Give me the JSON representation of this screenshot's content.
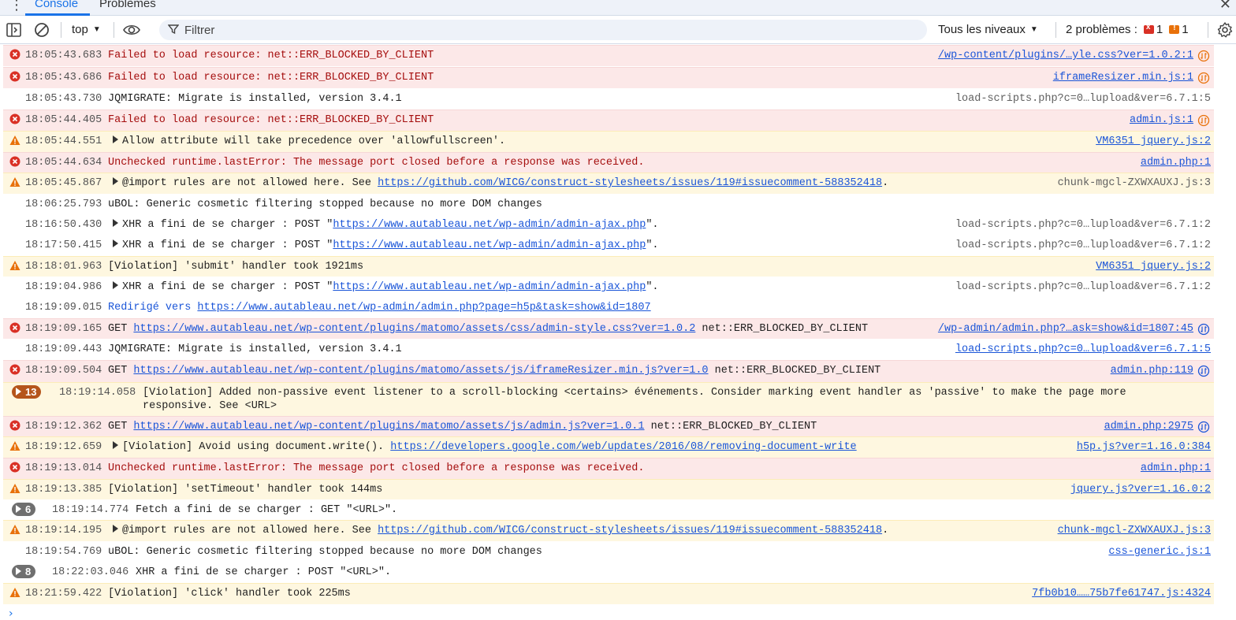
{
  "tabs": [
    {
      "label": "Console",
      "active": true
    },
    {
      "label": "Problèmes",
      "active": false
    }
  ],
  "toolbar": {
    "context": "top",
    "filter_placeholder": "Filtrer",
    "levels": "Tous les niveaux",
    "issues_label": "2 problèmes :",
    "issues_errors": "1",
    "issues_warnings": "1"
  },
  "colors": {
    "accent": "#1a73e8",
    "error_bg": "#fce8e8",
    "warning_bg": "#fef7e0",
    "error_icon": "#d93025",
    "warning_icon": "#e8710a"
  },
  "rows": [
    {
      "level": "error",
      "ts": "18:05:43.683",
      "msg": "Failed to load resource: net::ERR_BLOCKED_BY_CLIENT",
      "src": "/wp-content/plugins/…yle.css?ver=1.0.2:1",
      "src_icon": "blocked-request-icon"
    },
    {
      "level": "error",
      "ts": "18:05:43.686",
      "msg": "Failed to load resource: net::ERR_BLOCKED_BY_CLIENT",
      "src": "iframeResizer.min.js:1",
      "src_icon": "blocked-request-icon"
    },
    {
      "level": "info",
      "ts": "18:05:43.730",
      "msg": "JQMIGRATE: Migrate is installed, version 3.4.1",
      "src": "load-scripts.php?c=0…lupload&ver=6.7.1:5"
    },
    {
      "level": "error",
      "ts": "18:05:44.405",
      "msg": "Failed to load resource: net::ERR_BLOCKED_BY_CLIENT",
      "src": "admin.js:1",
      "src_icon": "blocked-request-icon"
    },
    {
      "level": "warning",
      "ts": "18:05:44.551",
      "msg": "Allow attribute will take precedence over 'allowfullscreen'.",
      "src": "VM6351 jquery.js:2"
    },
    {
      "level": "error",
      "ts": "18:05:44.634",
      "msg": "Unchecked runtime.lastError: The message port closed before a response was received.",
      "src": "admin.php:1"
    },
    {
      "level": "warning",
      "ts": "18:05:45.867",
      "msg_pre": "@import rules are not allowed here. See ",
      "msg_link": "https://github.com/WICG/construct-stylesheets/issues/119#issuecomment-588352418",
      "msg_post": ".",
      "src": "chunk-mgcl-ZXWXAUXJ.js:3"
    },
    {
      "level": "info",
      "ts": "18:06:25.793",
      "msg": "uBOL: Generic cosmetic filtering stopped because no more DOM changes",
      "src": ""
    },
    {
      "level": "info",
      "ts": "18:16:50.430",
      "msg_pre": "XHR a fini de se charger : POST \"",
      "msg_link": "https://www.autableau.net/wp-admin/admin-ajax.php",
      "msg_post": "\".",
      "src": "load-scripts.php?c=0…lupload&ver=6.7.1:2"
    },
    {
      "level": "info",
      "ts": "18:17:50.415",
      "msg_pre": "XHR a fini de se charger : POST \"",
      "msg_link": "https://www.autableau.net/wp-admin/admin-ajax.php",
      "msg_post": "\".",
      "src": "load-scripts.php?c=0…lupload&ver=6.7.1:2"
    },
    {
      "level": "warning",
      "ts": "18:18:01.963",
      "msg": "[Violation] 'submit' handler took 1921ms",
      "src": "VM6351 jquery.js:2"
    },
    {
      "level": "info",
      "ts": "18:19:04.986",
      "msg_pre": "XHR a fini de se charger : POST \"",
      "msg_link": "https://www.autableau.net/wp-admin/admin-ajax.php",
      "msg_post": "\".",
      "src": "load-scripts.php?c=0…lupload&ver=6.7.1:2"
    },
    {
      "level": "info",
      "ts": "18:19:09.015",
      "msg_pre": "Redirigé vers ",
      "msg_link": "https://www.autableau.net/wp-admin/admin.php?page=h5p&task=show&id=1807",
      "msg_post": "",
      "src": ""
    },
    {
      "level": "error",
      "ts": "18:19:09.165",
      "msg_pre": "GET ",
      "msg_link": "https://www.autableau.net/wp-content/plugins/matomo/assets/css/admin-style.css?ver=1.0.2",
      "msg_post": " net::ERR_BLOCKED_BY_CLIENT",
      "src": "/wp-admin/admin.php?…ask=show&id=1807:45",
      "src_icon": "network-icon"
    },
    {
      "level": "info",
      "ts": "18:19:09.443",
      "msg": "JQMIGRATE: Migrate is installed, version 3.4.1",
      "src": "load-scripts.php?c=0…lupload&ver=6.7.1:5"
    },
    {
      "level": "error",
      "ts": "18:19:09.504",
      "msg_pre": "GET ",
      "msg_link": "https://www.autableau.net/wp-content/plugins/matomo/assets/js/iframeResizer.min.js?ver=1.0",
      "msg_post": " net::ERR_BLOCKED_BY_CLIENT",
      "src": "admin.php:119",
      "src_icon": "network-icon"
    },
    {
      "level": "warning",
      "count": "13",
      "ts": "18:19:14.058",
      "msg": "[Violation] Added non-passive event listener to a scroll-blocking <certains> événements. Consider marking event handler as 'passive' to make the page more responsive. See <URL>",
      "src": ""
    },
    {
      "level": "error",
      "ts": "18:19:12.362",
      "msg_pre": "GET ",
      "msg_link": "https://www.autableau.net/wp-content/plugins/matomo/assets/js/admin.js?ver=1.0.1",
      "msg_post": " net::ERR_BLOCKED_BY_CLIENT",
      "src": "admin.php:2975",
      "src_icon": "network-icon"
    },
    {
      "level": "warning",
      "ts": "18:19:12.659",
      "msg_pre": "[Violation] Avoid using document.write(). ",
      "msg_link": "https://developers.google.com/web/updates/2016/08/removing-document-write",
      "msg_post": "",
      "src": "h5p.js?ver=1.16.0:384",
      "expandable": true
    },
    {
      "level": "error",
      "ts": "18:19:13.014",
      "msg": "Unchecked runtime.lastError: The message port closed before a response was received.",
      "src": "admin.php:1"
    },
    {
      "level": "warning",
      "ts": "18:19:13.385",
      "msg": "[Violation] 'setTimeout' handler took 144ms",
      "src": "jquery.js?ver=1.16.0:2"
    },
    {
      "level": "info",
      "count": "6",
      "ts": "18:19:14.774",
      "msg": "Fetch a fini de se charger : GET \"<URL>\".",
      "src": ""
    },
    {
      "level": "warning",
      "ts": "18:19:14.195",
      "msg_pre": "@import rules are not allowed here. See ",
      "msg_link": "https://github.com/WICG/construct-stylesheets/issues/119#issuecomment-588352418",
      "msg_post": ".",
      "src": "chunk-mgcl-ZXWXAUXJ.js:3"
    },
    {
      "level": "info",
      "ts": "18:19:54.769",
      "msg": "uBOL: Generic cosmetic filtering stopped because no more DOM changes",
      "src": "css-generic.js:1"
    },
    {
      "level": "info",
      "count": "8",
      "ts": "18:22:03.046",
      "msg": "XHR a fini de se charger : POST \"<URL>\".",
      "src": ""
    },
    {
      "level": "warning",
      "ts": "18:21:59.422",
      "msg": "[Violation] 'click' handler took 225ms",
      "src": "7fb0b10……75b7fe61747.js:4324"
    }
  ],
  "prompt_symbol": "›"
}
